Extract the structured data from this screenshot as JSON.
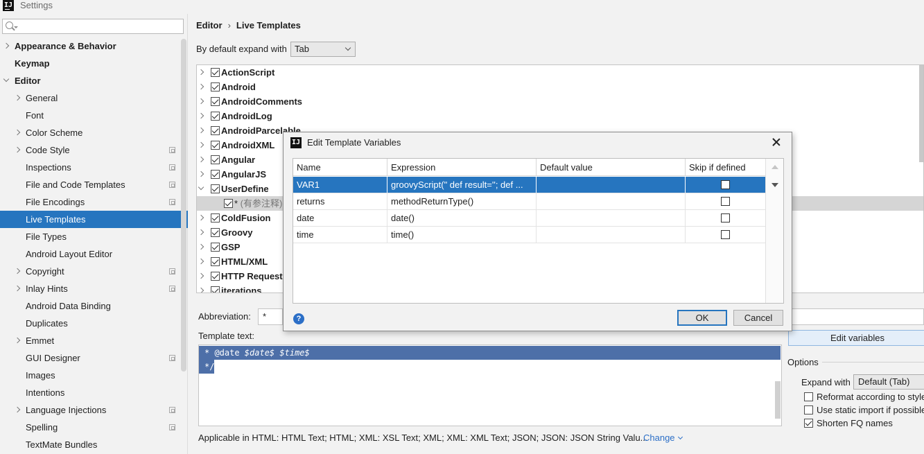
{
  "window": {
    "title": "Settings",
    "icon": "intellij-logo-icon"
  },
  "sidebar": {
    "search_placeholder": "",
    "items": [
      {
        "label": "Appearance & Behavior",
        "level": 0,
        "arrow": "right",
        "bold": true,
        "copy": false
      },
      {
        "label": "Keymap",
        "level": 0,
        "arrow": "none",
        "bold": true,
        "copy": false
      },
      {
        "label": "Editor",
        "level": 0,
        "arrow": "down",
        "bold": true,
        "copy": false
      },
      {
        "label": "General",
        "level": 1,
        "arrow": "right",
        "bold": false,
        "copy": false
      },
      {
        "label": "Font",
        "level": 1,
        "arrow": "none",
        "bold": false,
        "copy": false
      },
      {
        "label": "Color Scheme",
        "level": 1,
        "arrow": "right",
        "bold": false,
        "copy": false
      },
      {
        "label": "Code Style",
        "level": 1,
        "arrow": "right",
        "bold": false,
        "copy": true
      },
      {
        "label": "Inspections",
        "level": 1,
        "arrow": "none",
        "bold": false,
        "copy": true
      },
      {
        "label": "File and Code Templates",
        "level": 1,
        "arrow": "none",
        "bold": false,
        "copy": true
      },
      {
        "label": "File Encodings",
        "level": 1,
        "arrow": "none",
        "bold": false,
        "copy": true
      },
      {
        "label": "Live Templates",
        "level": 1,
        "arrow": "none",
        "bold": false,
        "copy": false,
        "selected": true
      },
      {
        "label": "File Types",
        "level": 1,
        "arrow": "none",
        "bold": false,
        "copy": false
      },
      {
        "label": "Android Layout Editor",
        "level": 1,
        "arrow": "none",
        "bold": false,
        "copy": false
      },
      {
        "label": "Copyright",
        "level": 1,
        "arrow": "right",
        "bold": false,
        "copy": true
      },
      {
        "label": "Inlay Hints",
        "level": 1,
        "arrow": "right",
        "bold": false,
        "copy": true
      },
      {
        "label": "Android Data Binding",
        "level": 1,
        "arrow": "none",
        "bold": false,
        "copy": false
      },
      {
        "label": "Duplicates",
        "level": 1,
        "arrow": "none",
        "bold": false,
        "copy": false
      },
      {
        "label": "Emmet",
        "level": 1,
        "arrow": "right",
        "bold": false,
        "copy": false
      },
      {
        "label": "GUI Designer",
        "level": 1,
        "arrow": "none",
        "bold": false,
        "copy": true
      },
      {
        "label": "Images",
        "level": 1,
        "arrow": "none",
        "bold": false,
        "copy": false
      },
      {
        "label": "Intentions",
        "level": 1,
        "arrow": "none",
        "bold": false,
        "copy": false
      },
      {
        "label": "Language Injections",
        "level": 1,
        "arrow": "right",
        "bold": false,
        "copy": true
      },
      {
        "label": "Spelling",
        "level": 1,
        "arrow": "none",
        "bold": false,
        "copy": true
      },
      {
        "label": "TextMate Bundles",
        "level": 1,
        "arrow": "none",
        "bold": false,
        "copy": false
      }
    ]
  },
  "main": {
    "breadcrumb": [
      "Editor",
      "Live Templates"
    ],
    "breadcrumb_sep": "›",
    "expand_label": "By default expand with",
    "expand_value": "Tab",
    "template_groups": [
      {
        "name": "ActionScript",
        "checked": true,
        "expanded": false
      },
      {
        "name": "Android",
        "checked": true,
        "expanded": false
      },
      {
        "name": "AndroidComments",
        "checked": true,
        "expanded": false
      },
      {
        "name": "AndroidLog",
        "checked": true,
        "expanded": false
      },
      {
        "name": "AndroidParcelable",
        "checked": true,
        "expanded": false
      },
      {
        "name": "AndroidXML",
        "checked": true,
        "expanded": false
      },
      {
        "name": "Angular",
        "checked": true,
        "expanded": false
      },
      {
        "name": "AngularJS",
        "checked": true,
        "expanded": false
      },
      {
        "name": "UserDefine",
        "checked": true,
        "expanded": true
      },
      {
        "name": "*",
        "desc": " (有参注释)",
        "checked": true,
        "child": true
      },
      {
        "name": "ColdFusion",
        "checked": true,
        "expanded": false
      },
      {
        "name": "Groovy",
        "checked": true,
        "expanded": false
      },
      {
        "name": "GSP",
        "checked": true,
        "expanded": false
      },
      {
        "name": "HTML/XML",
        "checked": true,
        "expanded": false
      },
      {
        "name": "HTTP Request",
        "checked": true,
        "expanded": false
      },
      {
        "name": "iterations",
        "checked": true,
        "expanded": false
      }
    ],
    "abbreviation_label": "Abbreviation:",
    "abbreviation_value": "*",
    "template_text_label": "Template text:",
    "template_lines": [
      {
        "prefix": "* @date ",
        "var1": "$date$",
        "mid": " ",
        "var2": "$time$"
      },
      {
        "text": "*/"
      }
    ],
    "applicable_text": "Applicable in HTML: HTML Text; HTML; XML: XSL Text; XML; XML: XML Text; JSON; JSON: JSON String Valu...",
    "change_link": "Change",
    "edit_variables_button": "Edit variables",
    "options_title": "Options",
    "expand_with_label": "Expand with",
    "expand_with_value": "Default (Tab)",
    "options": [
      {
        "label": "Reformat according to style",
        "checked": false
      },
      {
        "label": "Use static import if possible",
        "checked": false
      },
      {
        "label": "Shorten FQ names",
        "checked": true
      }
    ]
  },
  "dialog": {
    "title": "Edit Template Variables",
    "columns": [
      "Name",
      "Expression",
      "Default value",
      "Skip if defined"
    ],
    "rows": [
      {
        "name": "VAR1",
        "expression": "groovyScript(\" def result='';   def ...",
        "default": "",
        "skip": false,
        "selected": true
      },
      {
        "name": "returns",
        "expression": "methodReturnType()",
        "default": "",
        "skip": false
      },
      {
        "name": "date",
        "expression": "date()",
        "default": "",
        "skip": false
      },
      {
        "name": "time",
        "expression": "time()",
        "default": "",
        "skip": false
      }
    ],
    "help_glyph": "?",
    "ok_label": "OK",
    "cancel_label": "Cancel"
  },
  "colors": {
    "selection": "#2675bf",
    "editor_highlight": "#4d6fa8",
    "link": "#2c6fc7"
  }
}
